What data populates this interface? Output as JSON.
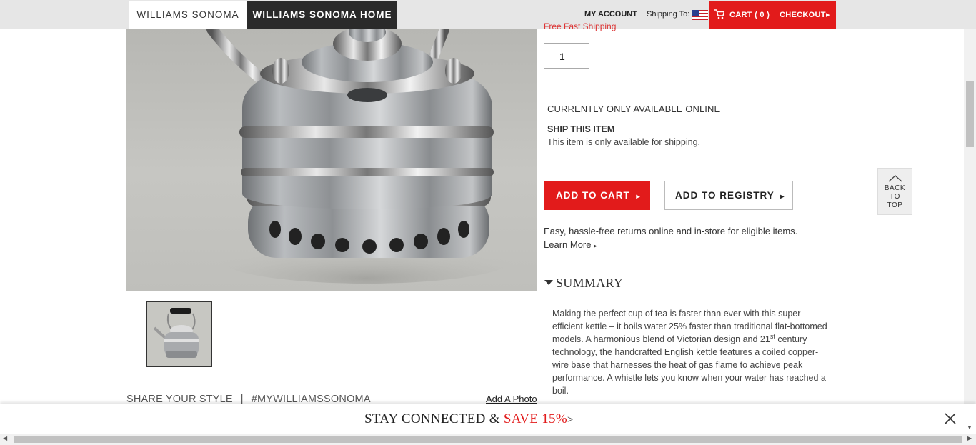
{
  "header": {
    "brand_tab_1": "WILLIAMS SONOMA",
    "brand_tab_2": "WILLIAMS SONOMA HOME",
    "my_account": "MY ACCOUNT",
    "shipping_to": "Shipping To:",
    "cart_label": "CART ( 0 )",
    "cart_separator": "|",
    "checkout_label": "CHECKOUT"
  },
  "product": {
    "promo_partial": "Free Fast Shipping",
    "quantity": "1",
    "availability": "CURRENTLY ONLY AVAILABLE ONLINE",
    "ship_heading": "SHIP THIS ITEM",
    "ship_note": "This item is only available for shipping.",
    "add_to_cart": "ADD TO CART",
    "add_to_registry": "ADD TO REGISTRY",
    "returns_text": "Easy, hassle-free returns online and in-store for eligible items.",
    "learn_more": "Learn More",
    "summary_title": "SUMMARY",
    "summary_part1": "Making the perfect cup of tea is faster than ever with this super-efficient kettle – it boils water 25% faster than traditional flat-bottomed models. A harmonious blend of Victorian design and 21",
    "summary_sup": "st",
    "summary_part2": " century technology, the handcrafted English kettle features a coiled copper-wire base that harnesses the heat of gas flame to achieve peak performance. A whistle lets you know when your water has reached a boil."
  },
  "social": {
    "share_label": "SHARE YOUR STYLE",
    "separator": "|",
    "hashtag": "#MYWILLIAMSSONOMA",
    "add_photo": "Add A Photo"
  },
  "back_to_top": {
    "line1": "BACK",
    "line2": "TO",
    "line3": "TOP"
  },
  "banner": {
    "text_part1": "STAY CONNECTED &",
    "text_part2": "SAVE 15%",
    "arrow": ">"
  },
  "icons": {
    "cart": "cart-icon",
    "flag": "us-flag-icon",
    "close": "close-icon",
    "chevron": "chevron-up-icon"
  },
  "colors": {
    "accent_red": "#e21b1b",
    "dark_tab": "#2a2a2a"
  }
}
